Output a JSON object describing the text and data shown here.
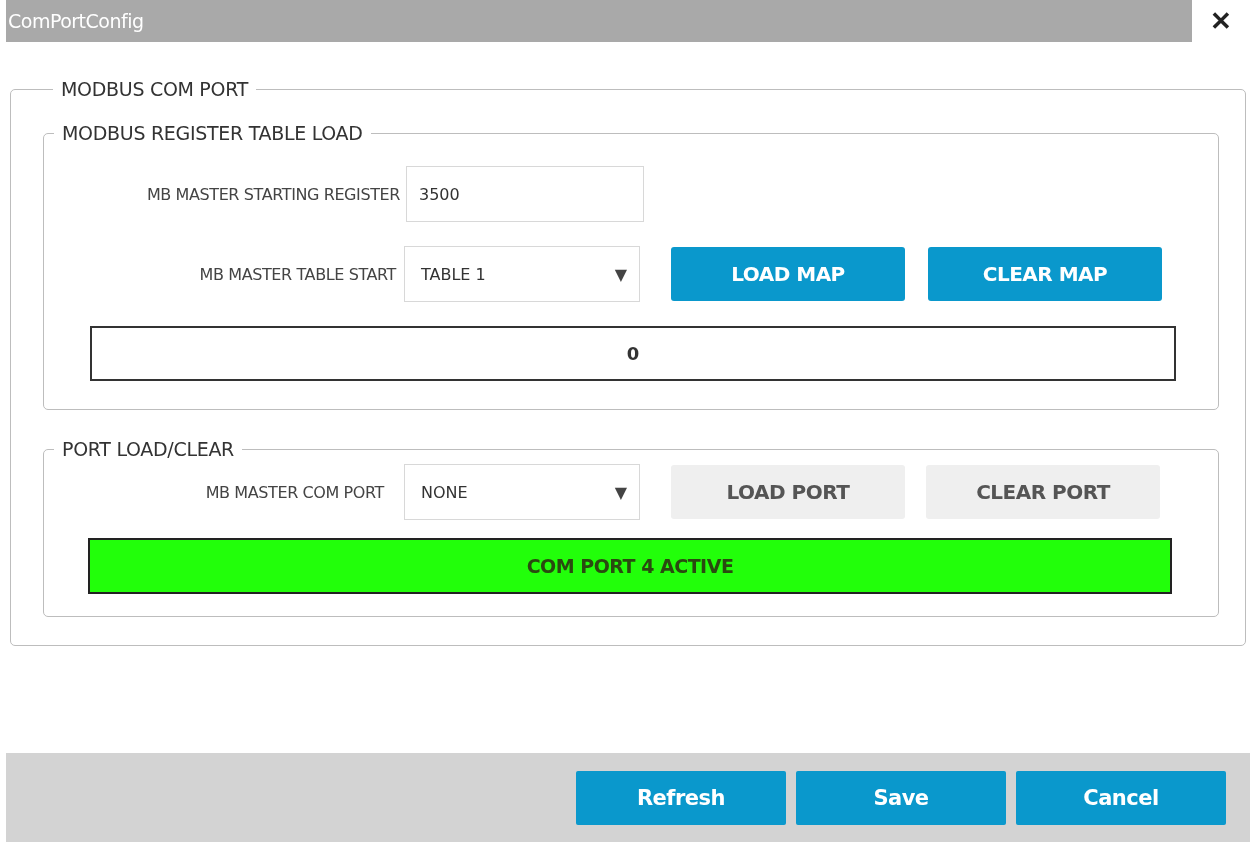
{
  "window": {
    "title": "ComPortConfig",
    "close": "✕"
  },
  "group": {
    "legend": "MODBUS COM PORT",
    "register_table": {
      "legend": "MODBUS REGISTER TABLE LOAD",
      "starting_register": {
        "label": "MB MASTER STARTING REGISTER",
        "value": "3500"
      },
      "table_start": {
        "label": "MB MASTER TABLE START",
        "value": "TABLE 1",
        "arrow": "▼"
      },
      "buttons": [
        {
          "label": "LOAD MAP",
          "disabled": false
        },
        {
          "label": "CLEAR MAP",
          "disabled": false
        }
      ],
      "output": "0"
    },
    "port": {
      "legend": "PORT LOAD/CLEAR",
      "com_port": {
        "label": "MB MASTER COM PORT",
        "value": "NONE",
        "arrow": "▼"
      },
      "buttons": [
        {
          "label": "LOAD PORT",
          "disabled": true
        },
        {
          "label": "CLEAR PORT",
          "disabled": true
        }
      ],
      "status": {
        "text": "COM PORT 4 ACTIVE",
        "active": true
      }
    }
  },
  "footer": {
    "buttons": [
      {
        "label": "Refresh"
      },
      {
        "label": "Save"
      },
      {
        "label": "Cancel"
      }
    ]
  }
}
